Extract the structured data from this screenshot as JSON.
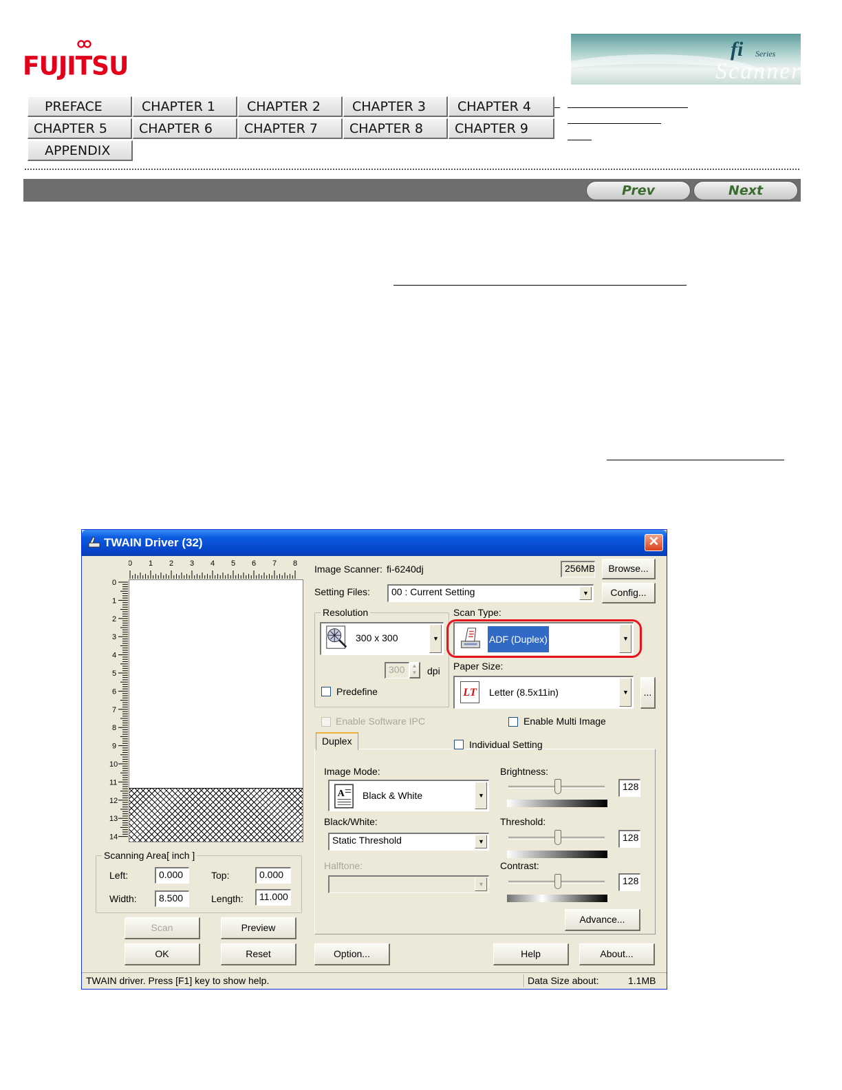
{
  "header": {
    "logo_text": "FUJITSU",
    "banner": {
      "fi": "fi",
      "series": "Series",
      "scanner": "Scanner"
    }
  },
  "nav": {
    "row1": [
      "PREFACE",
      "CHAPTER 1",
      "CHAPTER 2",
      "CHAPTER 3",
      "CHAPTER 4"
    ],
    "row2": [
      "CHAPTER 5",
      "CHAPTER 6",
      "CHAPTER 7",
      "CHAPTER 8",
      "CHAPTER 9"
    ],
    "row3": [
      "APPENDIX"
    ],
    "prev": "Prev",
    "next": "Next"
  },
  "dialog": {
    "title": "TWAIN Driver (32)",
    "close": "✕",
    "ruler_h": [
      "0",
      "1",
      "2",
      "3",
      "4",
      "5",
      "6",
      "7",
      "8"
    ],
    "ruler_v": [
      "0",
      "1",
      "2",
      "3",
      "4",
      "5",
      "6",
      "7",
      "8",
      "9",
      "10",
      "11",
      "12",
      "13",
      "14"
    ],
    "scanning_area": {
      "title": "Scanning Area[ inch ]",
      "left_label": "Left:",
      "left_value": "0.000",
      "top_label": "Top:",
      "top_value": "0.000",
      "width_label": "Width:",
      "width_value": "8.500",
      "length_label": "Length:",
      "length_value": "11.000"
    },
    "buttons": {
      "scan": "Scan",
      "preview": "Preview",
      "ok": "OK",
      "reset": "Reset",
      "option": "Option...",
      "help": "Help",
      "about": "About...",
      "browse": "Browse...",
      "config": "Config...",
      "advance": "Advance...",
      "paper_more": "..."
    },
    "image_scanner_label": "Image Scanner:",
    "image_scanner_value": "fi-6240dj",
    "memory": "256MB",
    "setting_files_label": "Setting Files:",
    "setting_files_value": "00 : Current Setting",
    "resolution": {
      "title": "Resolution",
      "value": "300 x 300",
      "custom": "300",
      "unit": "dpi",
      "predefine": "Predefine"
    },
    "scan_type": {
      "label": "Scan Type:",
      "value": "ADF (Duplex)"
    },
    "paper_size": {
      "label": "Paper Size:",
      "value": "Letter (8.5x11in)",
      "icon_text": "LT"
    },
    "enable_ipc": "Enable Software IPC",
    "enable_multi": "Enable Multi Image",
    "tab": "Duplex",
    "individual": "Individual Setting",
    "image_mode": {
      "label": "Image Mode:",
      "value": "Black & White"
    },
    "black_white": {
      "label": "Black/White:",
      "value": "Static Threshold"
    },
    "halftone": {
      "label": "Halftone:",
      "value": ""
    },
    "brightness": {
      "label": "Brightness:",
      "value": "128",
      "level": 0.5
    },
    "threshold": {
      "label": "Threshold:",
      "value": "128",
      "level": 0.5
    },
    "contrast": {
      "label": "Contrast:",
      "value": "128",
      "level": 0.5
    },
    "status": {
      "left": "TWAIN driver. Press [F1] key to show help.",
      "size_label": "Data Size about:",
      "size_value": "1.1MB"
    }
  },
  "colors": {
    "highlight": "#e8141c",
    "selection": "#316ac5",
    "title_bar": "#0a5ae0"
  }
}
